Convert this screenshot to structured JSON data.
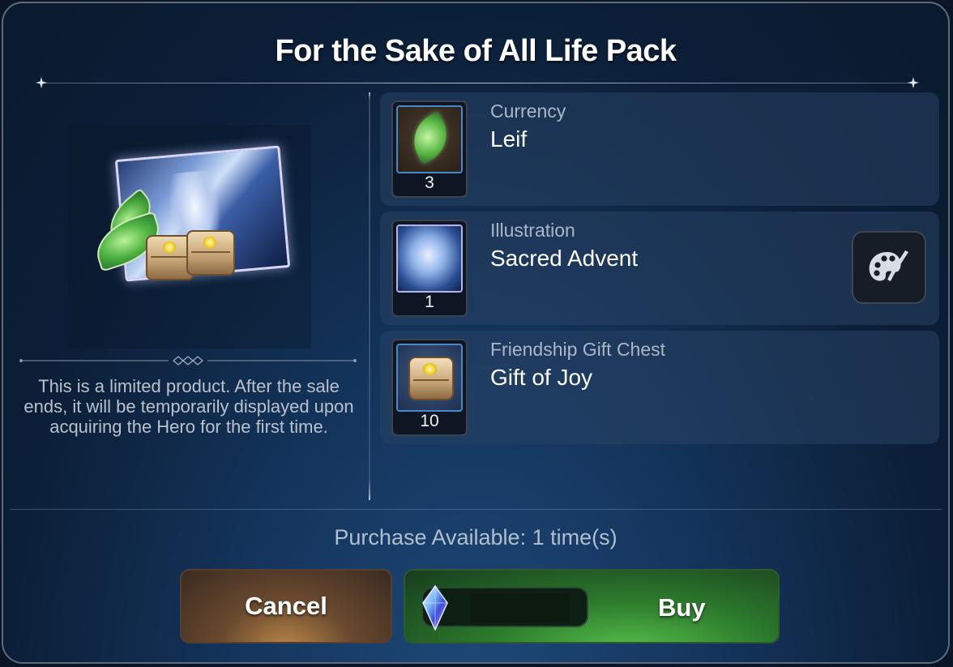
{
  "dialog": {
    "title": "For the Sake of All Life Pack",
    "description": "This is a limited product. After the sale ends, it will be temporarily displayed upon acquiring the Hero for the first time."
  },
  "items": [
    {
      "type": "Currency",
      "name": "Leif",
      "count": "3",
      "icon": "leaf-icon"
    },
    {
      "type": "Illustration",
      "name": "Sacred Advent",
      "count": "1",
      "icon": "illustration-icon",
      "has_preview": true,
      "preview_icon": "palette-icon"
    },
    {
      "type": "Friendship Gift Chest",
      "name": "Gift of Joy",
      "count": "10",
      "icon": "chest-icon"
    }
  ],
  "footer": {
    "purchase_available": "Purchase Available: 1 time(s)",
    "cancel_label": "Cancel",
    "buy_label": "Buy",
    "price_icon": "crystal-gem-icon"
  },
  "colors": {
    "cancel_button": "#6a4a2f",
    "buy_button": "#2c7a2c",
    "item_type_text": "#aab7c6"
  }
}
